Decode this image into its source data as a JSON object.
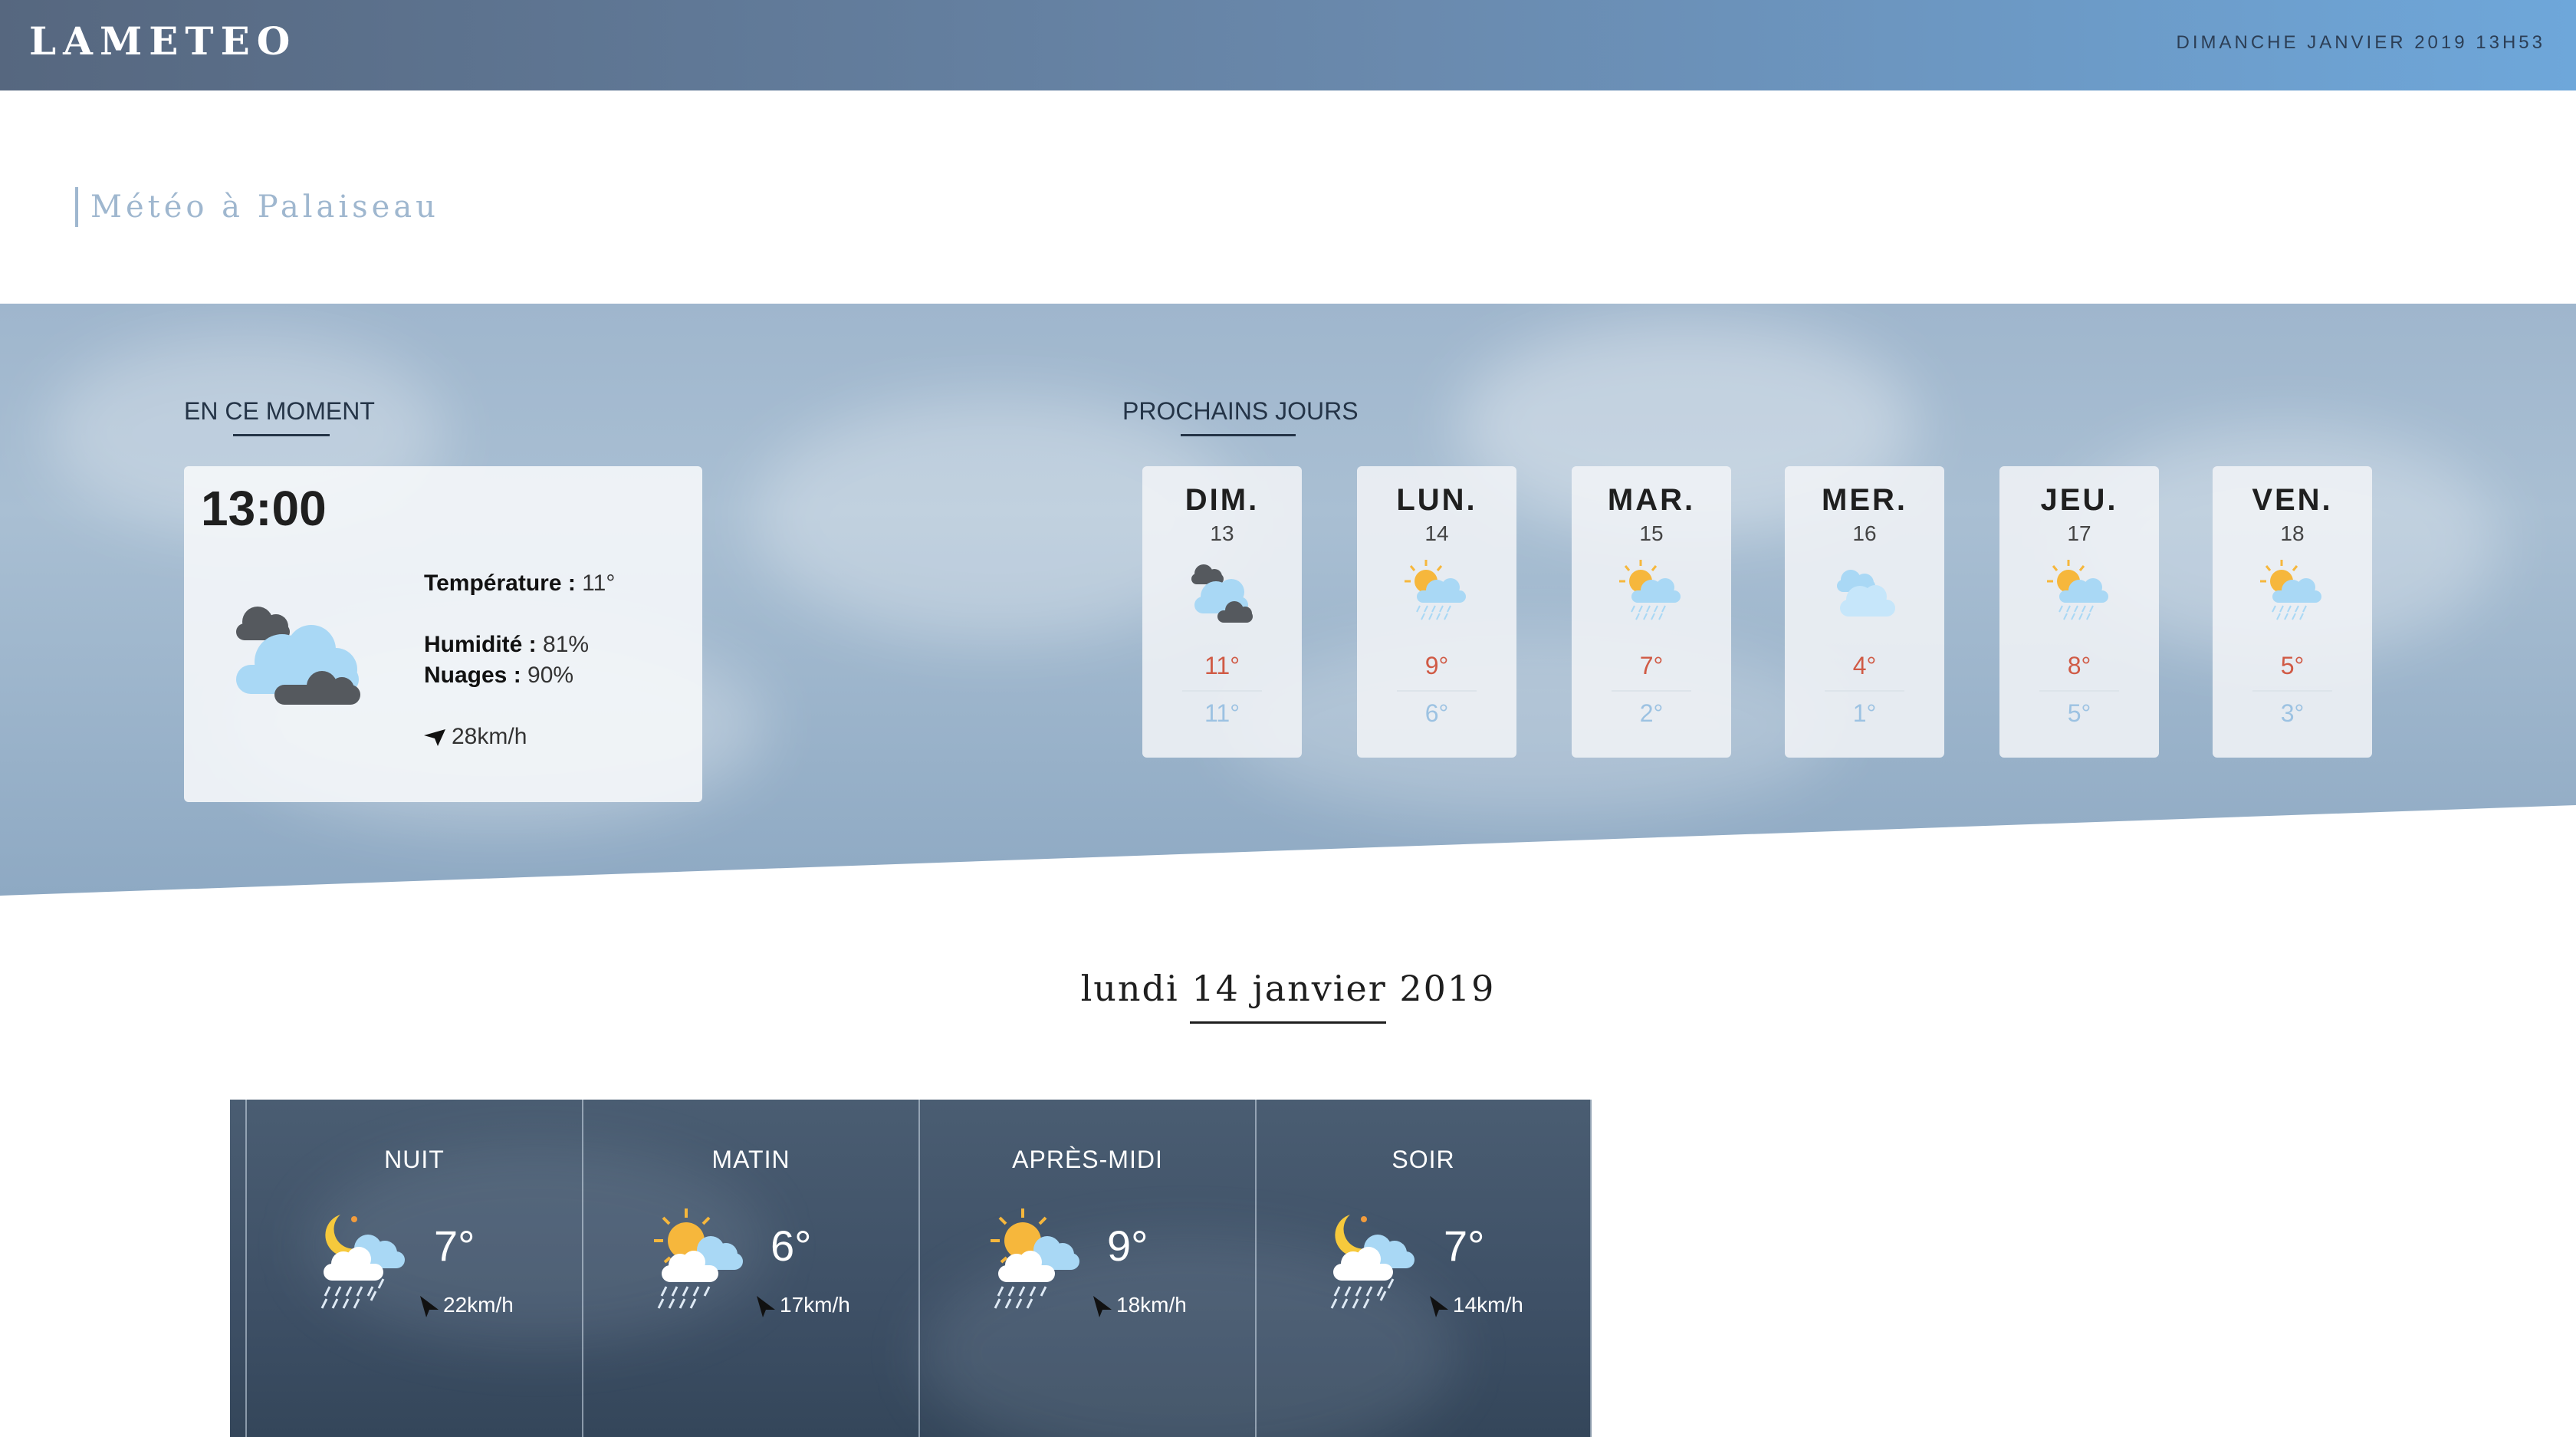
{
  "header": {
    "logo": "LAMETEO",
    "datetime": "DIMANCHE JANVIER 2019 13H53"
  },
  "city_title": "Météo à Palaiseau",
  "current": {
    "section_title": "EN CE MOMENT",
    "time": "13:00",
    "icon": "cloudy-icon",
    "temperature_label": "Température :",
    "temperature_value": "11°",
    "humidity_label": "Humidité :",
    "humidity_value": "81%",
    "clouds_label": "Nuages :",
    "clouds_value": "90%",
    "wind": "28km/h"
  },
  "forecast": {
    "section_title": "PROCHAINS JOURS",
    "days": [
      {
        "name": "DIM.",
        "num": "13",
        "icon": "cloudy-icon",
        "max": "11°",
        "min": "11°"
      },
      {
        "name": "LUN.",
        "num": "14",
        "icon": "sun-cloud-rain-icon",
        "max": "9°",
        "min": "6°"
      },
      {
        "name": "MAR.",
        "num": "15",
        "icon": "sun-cloud-rain-icon",
        "max": "7°",
        "min": "2°"
      },
      {
        "name": "MER.",
        "num": "16",
        "icon": "light-cloud-icon",
        "max": "4°",
        "min": "1°"
      },
      {
        "name": "JEU.",
        "num": "17",
        "icon": "sun-cloud-rain-icon",
        "max": "8°",
        "min": "5°"
      },
      {
        "name": "VEN.",
        "num": "18",
        "icon": "sun-cloud-rain-icon",
        "max": "5°",
        "min": "3°"
      }
    ]
  },
  "detail": {
    "date": "lundi 14 janvier 2019",
    "periods": [
      {
        "name": "NUIT",
        "icon": "moon-cloud-rain-icon",
        "temp": "7°",
        "wind": "22km/h"
      },
      {
        "name": "MATIN",
        "icon": "sun-cloud-rain-icon",
        "temp": "6°",
        "wind": "17km/h"
      },
      {
        "name": "APRÈS-MIDI",
        "icon": "sun-cloud-rain-icon",
        "temp": "9°",
        "wind": "18km/h"
      },
      {
        "name": "SOIR",
        "icon": "moon-cloud-rain-icon",
        "temp": "7°",
        "wind": "14km/h"
      }
    ]
  },
  "colors": {
    "max_temp": "#d05a45",
    "min_temp": "#9cc2e2",
    "accent": "#6ea7da"
  }
}
